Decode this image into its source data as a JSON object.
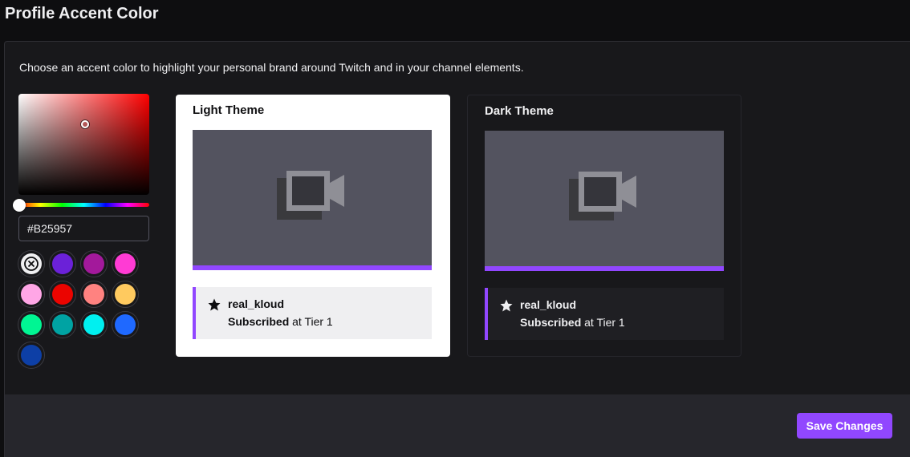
{
  "page": {
    "title": "Profile Accent Color"
  },
  "settings": {
    "description": "Choose an accent color to highlight your personal brand around Twitch and in your channel elements.",
    "hex_value": "#B25957",
    "swatches": [
      {
        "name": "clear",
        "color": "#efeff1",
        "icon": "close-icon"
      },
      {
        "name": "purple",
        "color": "#6b21d8"
      },
      {
        "name": "magenta",
        "color": "#a3199b"
      },
      {
        "name": "pink",
        "color": "#ff3bd4"
      },
      {
        "name": "light-pink",
        "color": "#ffa6e6"
      },
      {
        "name": "red",
        "color": "#eb0400"
      },
      {
        "name": "salmon",
        "color": "#ff8280"
      },
      {
        "name": "orange",
        "color": "#ffca5f"
      },
      {
        "name": "green",
        "color": "#00f593"
      },
      {
        "name": "teal",
        "color": "#00a3a3"
      },
      {
        "name": "cyan",
        "color": "#00f0f0"
      },
      {
        "name": "blue",
        "color": "#1f69ff"
      },
      {
        "name": "navy",
        "color": "#0d3fa6"
      }
    ]
  },
  "preview": {
    "light": {
      "title": "Light Theme",
      "username": "real_kloud",
      "sub_bold": "Subscribed",
      "sub_rest": " at Tier 1"
    },
    "dark": {
      "title": "Dark Theme",
      "username": "real_kloud",
      "sub_bold": "Subscribed",
      "sub_rest": " at Tier 1"
    },
    "accent_color": "#9147ff"
  },
  "footer": {
    "save_label": "Save Changes"
  }
}
